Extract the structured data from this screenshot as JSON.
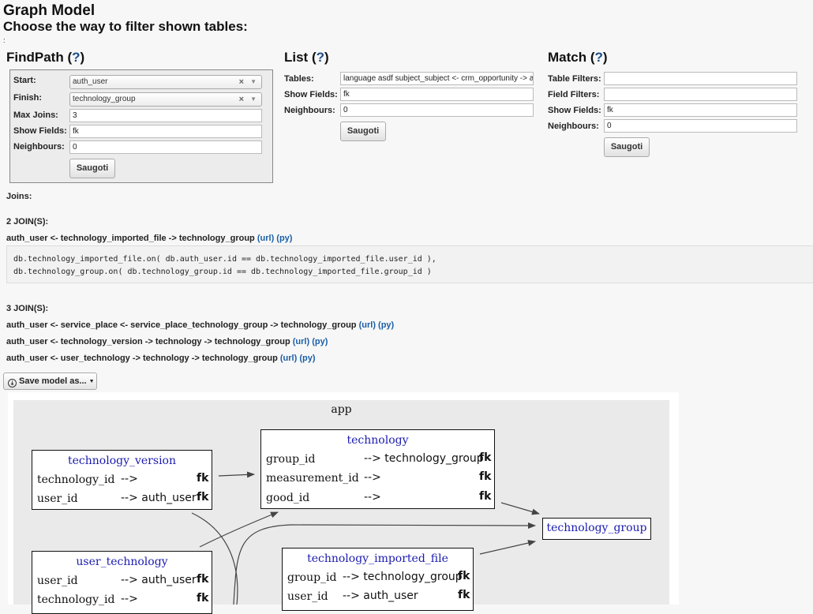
{
  "page": {
    "title": "Graph Model",
    "subtitle": "Choose the way to filter shown tables:",
    "colon": ":"
  },
  "findpath": {
    "title": "FindPath",
    "help": "?",
    "start_label": "Start:",
    "start_value": "auth_user",
    "finish_label": "Finish:",
    "finish_value": "technology_group",
    "max_joins_label": "Max Joins:",
    "max_joins_value": "3",
    "show_fields_label": "Show Fields:",
    "show_fields_value": "fk",
    "neighbours_label": "Neighbours:",
    "neighbours_value": "0",
    "submit": "Saugoti"
  },
  "list": {
    "title": "List",
    "help": "?",
    "tables_label": "Tables:",
    "tables_value": "language asdf subject_subject <- crm_opportunity -> auth_user",
    "show_fields_label": "Show Fields:",
    "show_fields_value": "fk",
    "neighbours_label": "Neighbours:",
    "neighbours_value": "0",
    "submit": "Saugoti"
  },
  "match": {
    "title": "Match",
    "help": "?",
    "table_filters_label": "Table Filters:",
    "table_filters_value": "",
    "field_filters_label": "Field Filters:",
    "field_filters_value": "",
    "show_fields_label": "Show Fields:",
    "show_fields_value": "fk",
    "neighbours_label": "Neighbours:",
    "neighbours_value": "0",
    "submit": "Saugoti"
  },
  "joins": {
    "label": "Joins:",
    "group2_header": "2 JOIN(S):",
    "group2": [
      {
        "path": "auth_user <- technology_imported_file -> technology_group",
        "url": "(url)",
        "py": "(py)"
      }
    ],
    "code_lines": [
      "db.technology_imported_file.on( db.auth_user.id == db.technology_imported_file.user_id ),",
      "db.technology_group.on( db.technology_group.id == db.technology_imported_file.group_id )"
    ],
    "group3_header": "3 JOIN(S):",
    "group3": [
      {
        "path": "auth_user <- service_place <- service_place_technology_group -> technology_group",
        "url": "(url)",
        "py": "(py)"
      },
      {
        "path": "auth_user <- technology_version -> technology -> technology_group",
        "url": "(url)",
        "py": "(py)"
      },
      {
        "path": "auth_user <- user_technology -> technology -> technology_group",
        "url": "(url)",
        "py": "(py)"
      }
    ]
  },
  "save": {
    "label": "Save model as...",
    "icon": "save-icon"
  },
  "graph": {
    "cluster_label": "app",
    "nodes": {
      "technology_version": {
        "title": "technology_version",
        "rows": [
          {
            "field": "technology_id",
            "ref": "-->",
            "fk": "fk"
          },
          {
            "field": "user_id",
            "ref": "--> auth_user",
            "fk": "fk"
          }
        ]
      },
      "technology": {
        "title": "technology",
        "rows": [
          {
            "field": "group_id",
            "ref": "--> technology_group",
            "fk": "fk"
          },
          {
            "field": "measurement_id",
            "ref": "-->",
            "fk": "fk"
          },
          {
            "field": "good_id",
            "ref": "-->",
            "fk": "fk"
          }
        ]
      },
      "technology_group": {
        "title": "technology_group"
      },
      "user_technology": {
        "title": "user_technology",
        "rows": [
          {
            "field": "user_id",
            "ref": "--> auth_user",
            "fk": "fk"
          },
          {
            "field": "technology_id",
            "ref": "-->",
            "fk": "fk"
          }
        ]
      },
      "technology_imported_file": {
        "title": "technology_imported_file",
        "rows": [
          {
            "field": "group_id",
            "ref": "--> technology_group",
            "fk": "fk"
          },
          {
            "field": "user_id",
            "ref": "--> auth_user",
            "fk": "fk"
          }
        ]
      }
    }
  }
}
